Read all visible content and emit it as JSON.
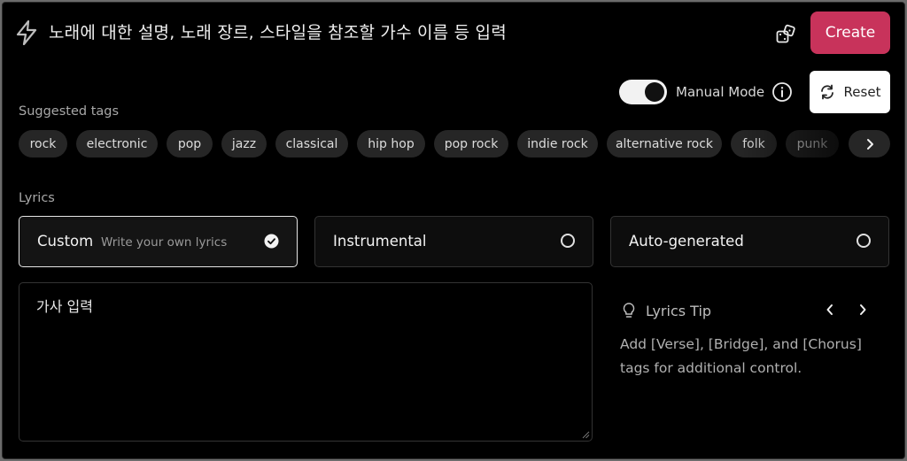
{
  "prompt": {
    "placeholder": "노래에 대한 설명, 노래 장르, 스타일을 참조할 가수 이름 등 입력"
  },
  "header": {
    "create_label": "Create",
    "random_icon": "dice-icon"
  },
  "controls": {
    "manual_mode_label": "Manual Mode",
    "manual_mode_on": true,
    "reset_label": "Reset"
  },
  "tags": {
    "label": "Suggested tags",
    "items": [
      "rock",
      "electronic",
      "pop",
      "jazz",
      "classical",
      "hip hop",
      "pop rock",
      "indie rock",
      "alternative rock",
      "folk",
      "punk"
    ]
  },
  "lyrics": {
    "label": "Lyrics",
    "options": [
      {
        "title": "Custom",
        "subtitle": "Write your own lyrics",
        "selected": true
      },
      {
        "title": "Instrumental",
        "subtitle": "",
        "selected": false
      },
      {
        "title": "Auto-generated",
        "subtitle": "",
        "selected": false
      }
    ],
    "input_placeholder": "가사 입력"
  },
  "tip": {
    "title": "Lyrics Tip",
    "body": "Add [Verse], [Bridge], and [Chorus] tags for additional control."
  },
  "colors": {
    "accent": "#c8335b",
    "background": "#000000",
    "chip": "#262626"
  }
}
